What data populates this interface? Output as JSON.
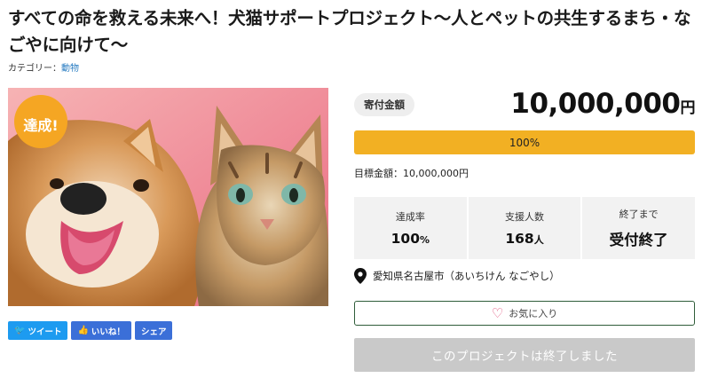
{
  "project": {
    "title": "すべての命を救える未来へ！犬猫サポートプロジェクト〜人とペットの共生するまち・なごやに向けて〜",
    "category_label": "カテゴリー：",
    "category_link": "動物"
  },
  "hero": {
    "badge": "達成!"
  },
  "share": {
    "tweet": "ツイート",
    "like": "いいね！",
    "share": "シェア"
  },
  "funding": {
    "badge": "寄付金額",
    "amount": "10,000,000",
    "amount_unit": "円",
    "progress_percent": 100,
    "progress_label": "100%",
    "goal": "目標金額：10,000,000円"
  },
  "stats": {
    "rate_label": "達成率",
    "rate_value": "100",
    "rate_unit": "%",
    "supporters_label": "支援人数",
    "supporters_value": "168",
    "supporters_unit": "人",
    "deadline_label": "終了まで",
    "deadline_value": "受付終了"
  },
  "location": "愛知県名古屋市（あいちけん なごやし）",
  "favorite_label": "お気に入り",
  "ended_label": "このプロジェクトは終了しました",
  "colors": {
    "accent": "#f2b023",
    "tweet": "#1d9bf0",
    "facebook": "#3b6fd8",
    "fav_border": "#2f5d3a",
    "disabled": "#c9c9c9"
  }
}
